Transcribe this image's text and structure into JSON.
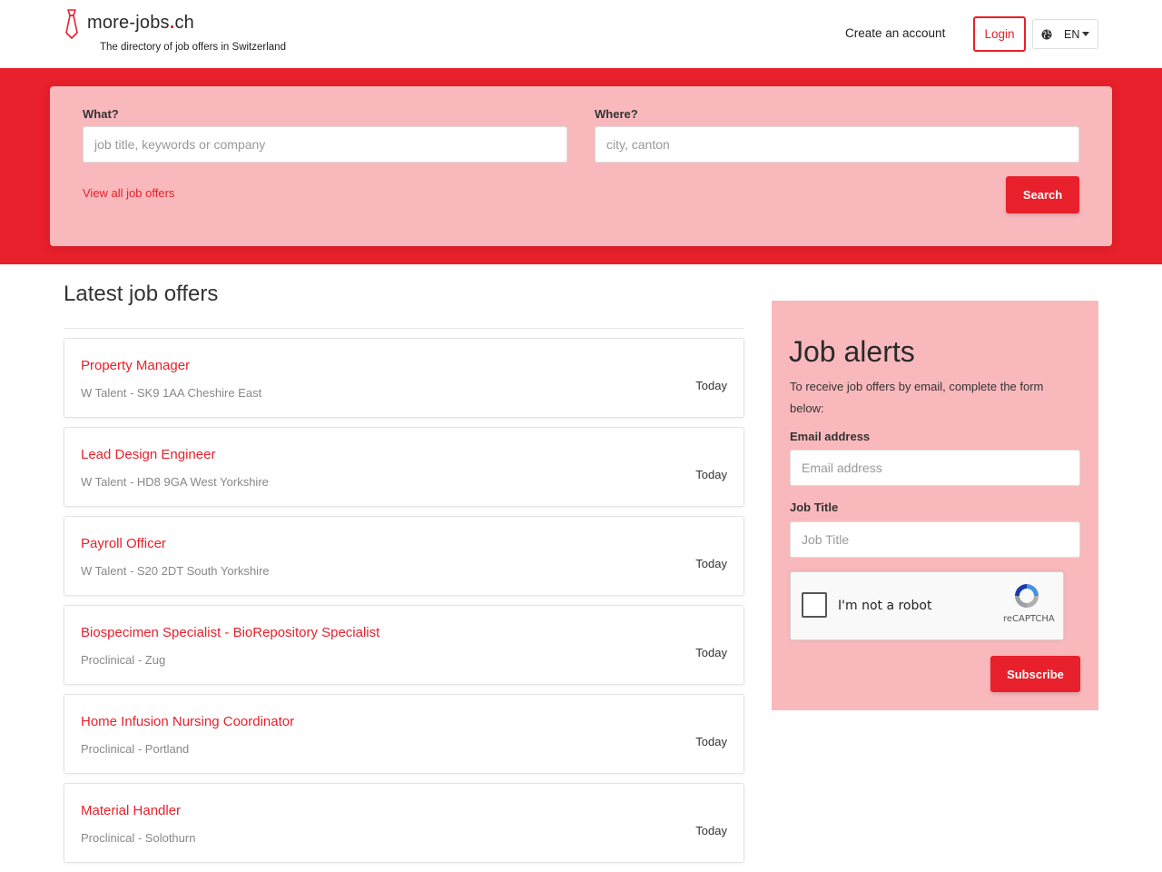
{
  "header": {
    "logo_prefix": "more-jobs",
    "logo_dot": ".",
    "logo_suffix": "ch",
    "tagline": "The directory of job offers in Switzerland",
    "create_account": "Create an account",
    "login": "Login",
    "language": "EN"
  },
  "search": {
    "what_label": "What?",
    "what_placeholder": "job title, keywords or company",
    "where_label": "Where?",
    "where_placeholder": "city, canton",
    "view_all": "View all job offers",
    "search_button": "Search"
  },
  "main": {
    "title": "Latest job offers",
    "jobs": [
      {
        "title": "Property Manager",
        "meta": "W Talent - SK9 1AA Cheshire East",
        "date": "Today"
      },
      {
        "title": "Lead Design Engineer",
        "meta": "W Talent - HD8 9GA West Yorkshire",
        "date": "Today"
      },
      {
        "title": "Payroll Officer",
        "meta": "W Talent - S20 2DT South Yorkshire",
        "date": "Today"
      },
      {
        "title": "Biospecimen Specialist - BioRepository Specialist",
        "meta": "Proclinical - Zug",
        "date": "Today"
      },
      {
        "title": "Home Infusion Nursing Coordinator",
        "meta": "Proclinical - Portland",
        "date": "Today"
      },
      {
        "title": "Material Handler",
        "meta": "Proclinical - Solothurn",
        "date": "Today"
      }
    ]
  },
  "alerts": {
    "title": "Job alerts",
    "intro": "To receive job offers by email, complete the form below:",
    "email_label": "Email address",
    "email_placeholder": "Email address",
    "job_title_label": "Job Title",
    "job_title_placeholder": "Job Title",
    "captcha_text": "I'm not a robot",
    "captcha_brand": "reCAPTCHA",
    "subscribe": "Subscribe"
  },
  "colors": {
    "accent": "#e8202b",
    "panel": "#f9b9bc"
  },
  "icons": [
    "tie-logo-icon",
    "globe-icon",
    "caret-down-icon",
    "recaptcha-icon"
  ]
}
